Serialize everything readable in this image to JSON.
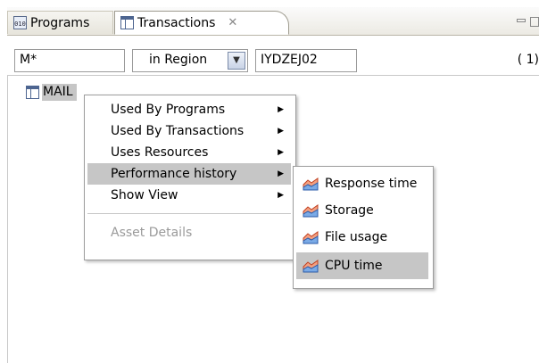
{
  "tabs": [
    {
      "label": "Programs",
      "icon": "program-icon",
      "active": false
    },
    {
      "label": "Transactions",
      "icon": "transaction-icon",
      "active": true,
      "close_glyph": "✕"
    }
  ],
  "filter": {
    "pattern_value": "M*",
    "scope_value": "in Region",
    "region_value": "IYDZEJ02",
    "result_count": "( 1)"
  },
  "tree": {
    "items": [
      {
        "label": "MAIL"
      }
    ]
  },
  "context_menu": {
    "items": [
      {
        "label": "Used By Programs",
        "submenu": true
      },
      {
        "label": "Used By Transactions",
        "submenu": true
      },
      {
        "label": "Uses Resources",
        "submenu": true
      },
      {
        "label": "Performance history",
        "submenu": true,
        "selected": true
      },
      {
        "label": "Show View",
        "submenu": true
      },
      {
        "label": "Asset Details",
        "disabled": true
      }
    ]
  },
  "submenu": {
    "items": [
      {
        "label": "Response time"
      },
      {
        "label": "Storage"
      },
      {
        "label": "File usage"
      },
      {
        "label": "CPU time",
        "selected": true
      }
    ]
  },
  "colors": {
    "selection": "#c6c6c6",
    "tab_border": "#9e9b8f",
    "chart_icon_fill": "#e86040",
    "chart_icon_fill2": "#4a86d8"
  }
}
